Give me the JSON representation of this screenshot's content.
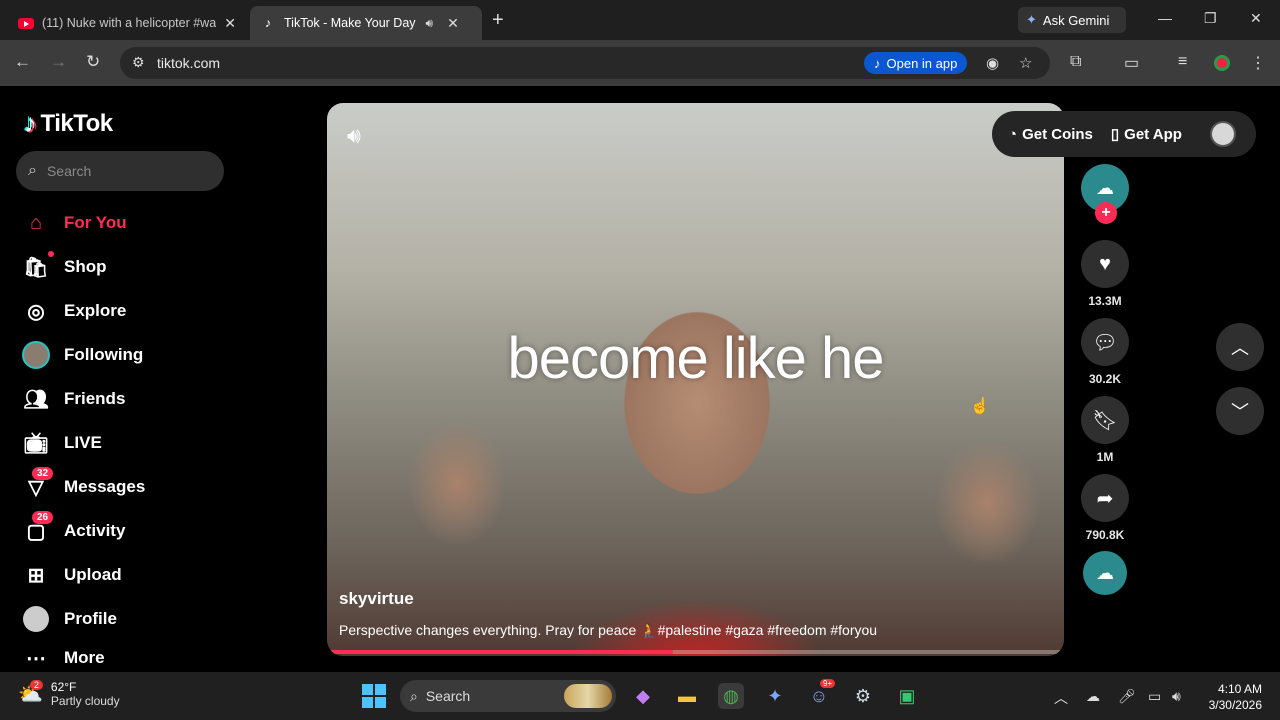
{
  "browser": {
    "tabs": [
      {
        "title": "(11) Nuke with a helicopter #wa",
        "close": "✕"
      },
      {
        "title": "TikTok - Make Your Day",
        "close": "✕"
      }
    ],
    "new_tab": "+",
    "ask_gemini": "Ask Gemini",
    "url": "tiktok.com",
    "open_in_app": "Open in app",
    "window_controls": {
      "minimize": "—",
      "restore": "❐",
      "close": "✕"
    }
  },
  "sidebar": {
    "logo": "TikTok",
    "search_placeholder": "Search",
    "items": [
      {
        "label": "For You",
        "icon": "home-icon"
      },
      {
        "label": "Shop",
        "icon": "shopping-bag-icon"
      },
      {
        "label": "Explore",
        "icon": "compass-icon"
      },
      {
        "label": "Following",
        "icon": "avatar-icon"
      },
      {
        "label": "Friends",
        "icon": "friends-icon"
      },
      {
        "label": "LIVE",
        "icon": "live-tv-icon"
      },
      {
        "label": "Messages",
        "icon": "send-icon",
        "badge": "32"
      },
      {
        "label": "Activity",
        "icon": "inbox-icon",
        "badge": "26"
      },
      {
        "label": "Upload",
        "icon": "plus-square-icon"
      },
      {
        "label": "Profile",
        "icon": "profile-avatar-icon"
      },
      {
        "label": "More",
        "icon": "more-dots-icon"
      }
    ]
  },
  "topbar": {
    "get_coins": "Get Coins",
    "get_app": "Get App"
  },
  "video": {
    "caption": "become like he",
    "author": "skyvirtue",
    "description": "Perspective changes everything. Pray for peace 🧎#palestine #gaza #freedom #foryou",
    "progress": 0.47
  },
  "actions": {
    "likes": "13.3M",
    "comments": "30.2K",
    "saves": "1M",
    "shares": "790.8K"
  },
  "taskbar": {
    "temperature": "62°F",
    "weather": "Partly cloudy",
    "weather_badge": "2",
    "search": "Search",
    "discord_badge": "9+",
    "time": "4:10 AM",
    "date": "3/30/2026"
  },
  "colors": {
    "accent": "#fe2c55",
    "teal": "#25f4ee",
    "chrome_bg": "#1f1f1f",
    "sidebar_bg": "#000000"
  }
}
